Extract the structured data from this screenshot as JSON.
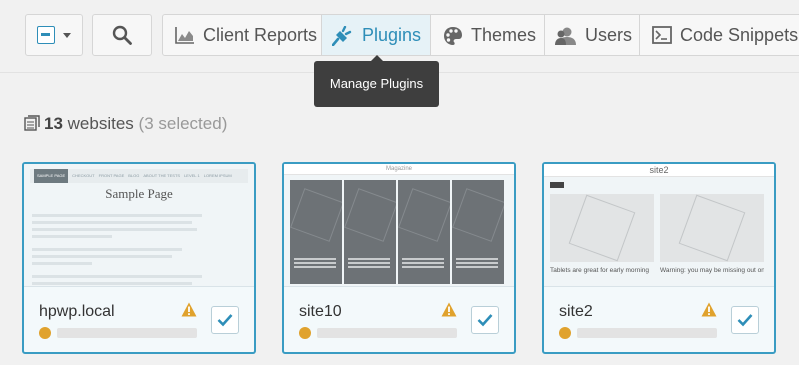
{
  "toolbar": {
    "tabs": [
      {
        "label": "Client Reports",
        "icon": "chart-area-icon"
      },
      {
        "label": "Plugins",
        "icon": "plug-icon"
      },
      {
        "label": "Themes",
        "icon": "palette-icon"
      },
      {
        "label": "Users",
        "icon": "users-icon"
      },
      {
        "label": "Code Snippets",
        "icon": "terminal-icon"
      }
    ],
    "active_tab": "Plugins",
    "tooltip": "Manage Plugins"
  },
  "summary": {
    "count": "13",
    "count_label": "websites",
    "selected": "(3 selected)"
  },
  "sites": [
    {
      "name": "hpwp.local",
      "selected": true,
      "warning": true,
      "thumb_title": "Sample Page"
    },
    {
      "name": "site10",
      "selected": true,
      "warning": true,
      "thumb_title": "Magazine"
    },
    {
      "name": "site2",
      "selected": true,
      "warning": true,
      "thumb_title": "site2"
    }
  ],
  "thumbs": {
    "t1_nav": [
      "SAMPLE PAGE",
      "CHECKOUT",
      "FRONT PAGE",
      "BLOG",
      "ABOUT THE TESTS",
      "LEVEL 1",
      "LOREM IPSUM"
    ],
    "t3_captions": [
      "Tablets are great for early morning",
      "Warning: you may be missing out on"
    ]
  },
  "colors": {
    "accent": "#2e8eb8",
    "warning": "#e0a22d",
    "tooltip_bg": "#3e3e3e"
  }
}
